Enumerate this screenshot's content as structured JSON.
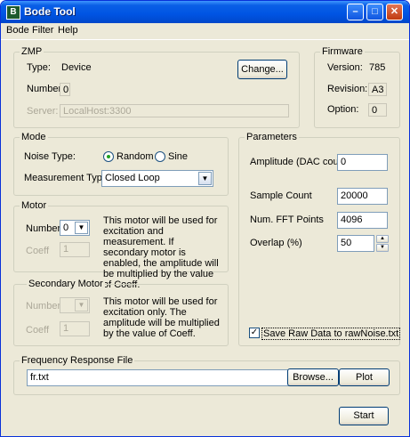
{
  "window": {
    "title": "Bode Tool",
    "icon_letter": "B"
  },
  "menu": {
    "items": [
      "Bode",
      "Filter",
      "Help"
    ]
  },
  "zmp": {
    "label": "ZMP",
    "type_label": "Type:",
    "type_value": "Device",
    "number_label": "Number:",
    "number_value": "0",
    "server_label": "Server:",
    "server_value": "LocalHost:3300",
    "change_button": "Change..."
  },
  "firmware": {
    "label": "Firmware",
    "version_label": "Version:",
    "version_value": "785",
    "revision_label": "Revision:",
    "revision_value": "A3",
    "option_label": "Option:",
    "option_value": "0"
  },
  "mode": {
    "label": "Mode",
    "noise_type_label": "Noise Type:",
    "random_label": "Random",
    "sine_label": "Sine",
    "selected_noise": "Random",
    "measurement_type_label": "Measurement Type:",
    "measurement_type_value": "Closed Loop"
  },
  "motor": {
    "label": "Motor",
    "number_label": "Number",
    "number_value": "0",
    "coeff_label": "Coeff",
    "coeff_value": "1",
    "description": "This motor will be used for excitation and measurement. If secondary motor is enabled, the amplitude will be multiplied by the value of Coeff."
  },
  "secondary_motor": {
    "label": "Secondary Motor",
    "number_label": "Number",
    "number_value": "",
    "coeff_label": "Coeff",
    "coeff_value": "1",
    "description": "This motor will be used for excitation only. The amplitude will be multiplied by the value of Coeff."
  },
  "parameters": {
    "label": "Parameters",
    "amplitude_label": "Amplitude (DAC counts)",
    "amplitude_value": "0",
    "sample_count_label": "Sample Count",
    "sample_count_value": "20000",
    "fft_points_label": "Num. FFT Points",
    "fft_points_value": "4096",
    "overlap_label": "Overlap (%)",
    "overlap_value": "50",
    "save_raw_label": "Save Raw Data to rawNoise.txt",
    "save_raw_checked": true
  },
  "freq_file": {
    "label": "Frequency Response File",
    "path_value": "fr.txt",
    "browse_button": "Browse...",
    "plot_button": "Plot"
  },
  "start_button": "Start",
  "colors": {
    "titlebar": "#0054e3",
    "window_bg": "#ece9d8",
    "close_button": "#c03b10"
  }
}
